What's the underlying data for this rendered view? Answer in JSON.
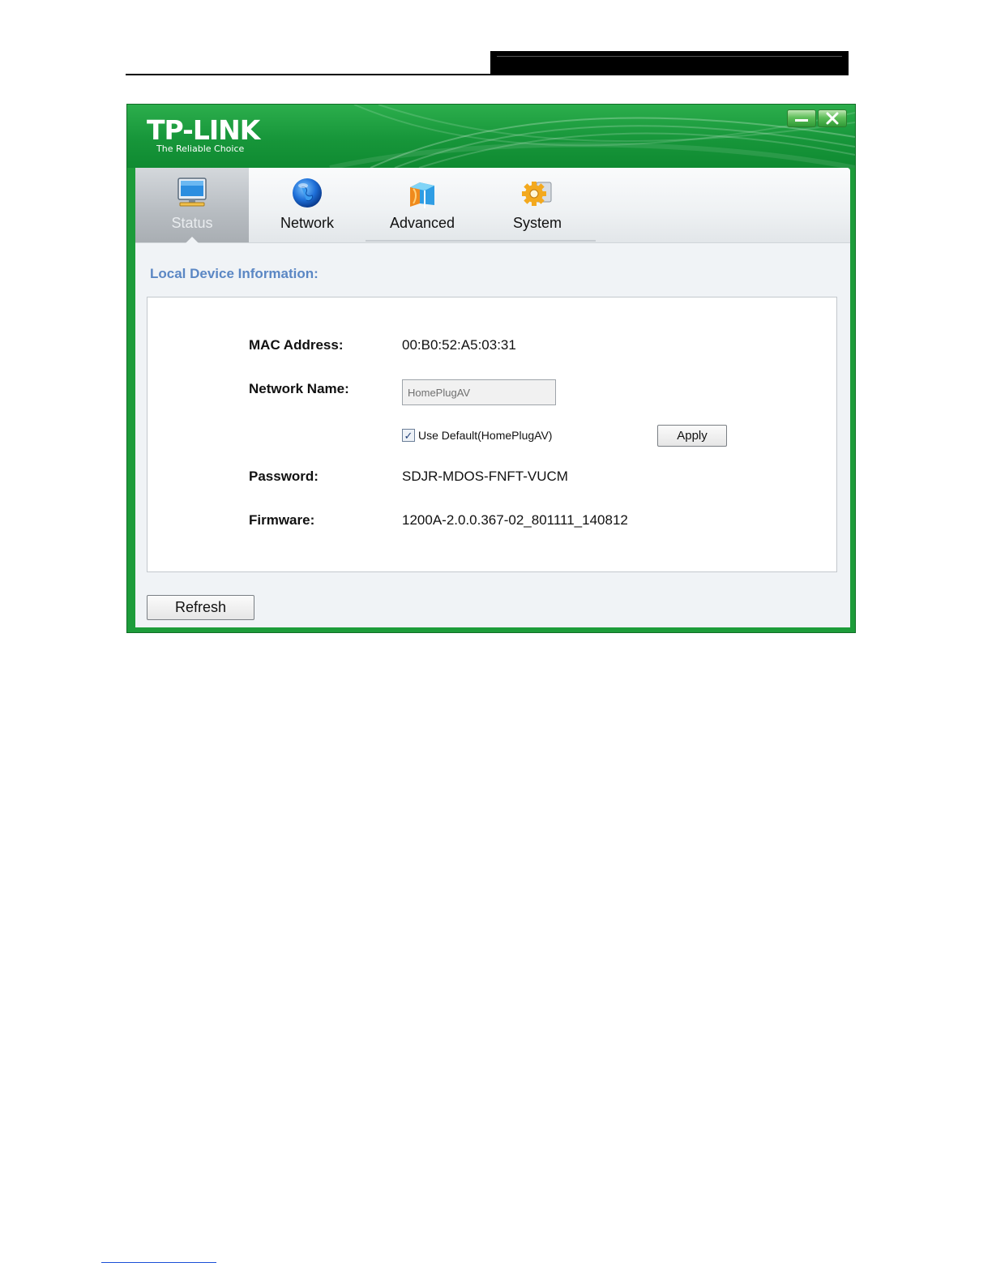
{
  "app": {
    "logo": "TP-LINK",
    "tagline": "The Reliable Choice",
    "minimize_icon": "minimize-icon",
    "close_icon": "close-icon"
  },
  "tabs": [
    {
      "label": "Status",
      "icon": "monitor-icon",
      "active": true
    },
    {
      "label": "Network",
      "icon": "globe-icon",
      "active": false
    },
    {
      "label": "Advanced",
      "icon": "advanced-cube-icon",
      "active": false
    },
    {
      "label": "System",
      "icon": "gear-icon",
      "active": false
    }
  ],
  "section": {
    "title": "Local Device Information:"
  },
  "device": {
    "mac_label": "MAC  Address:",
    "mac_value": "00:B0:52:A5:03:31",
    "network_name_label": "Network Name:",
    "network_name_value": "HomePlugAV",
    "use_default_label": "Use Default(HomePlugAV)",
    "use_default_checked": true,
    "apply_label": "Apply",
    "password_label": "Password:",
    "password_value": "SDJR-MDOS-FNFT-VUCM",
    "firmware_label": "Firmware:",
    "firmware_value": "1200A-2.0.0.367-02_801111_140812"
  },
  "footer": {
    "refresh_label": "Refresh"
  },
  "colors": {
    "brand_green": "#1d9c3a",
    "section_title": "#5b87c4"
  }
}
